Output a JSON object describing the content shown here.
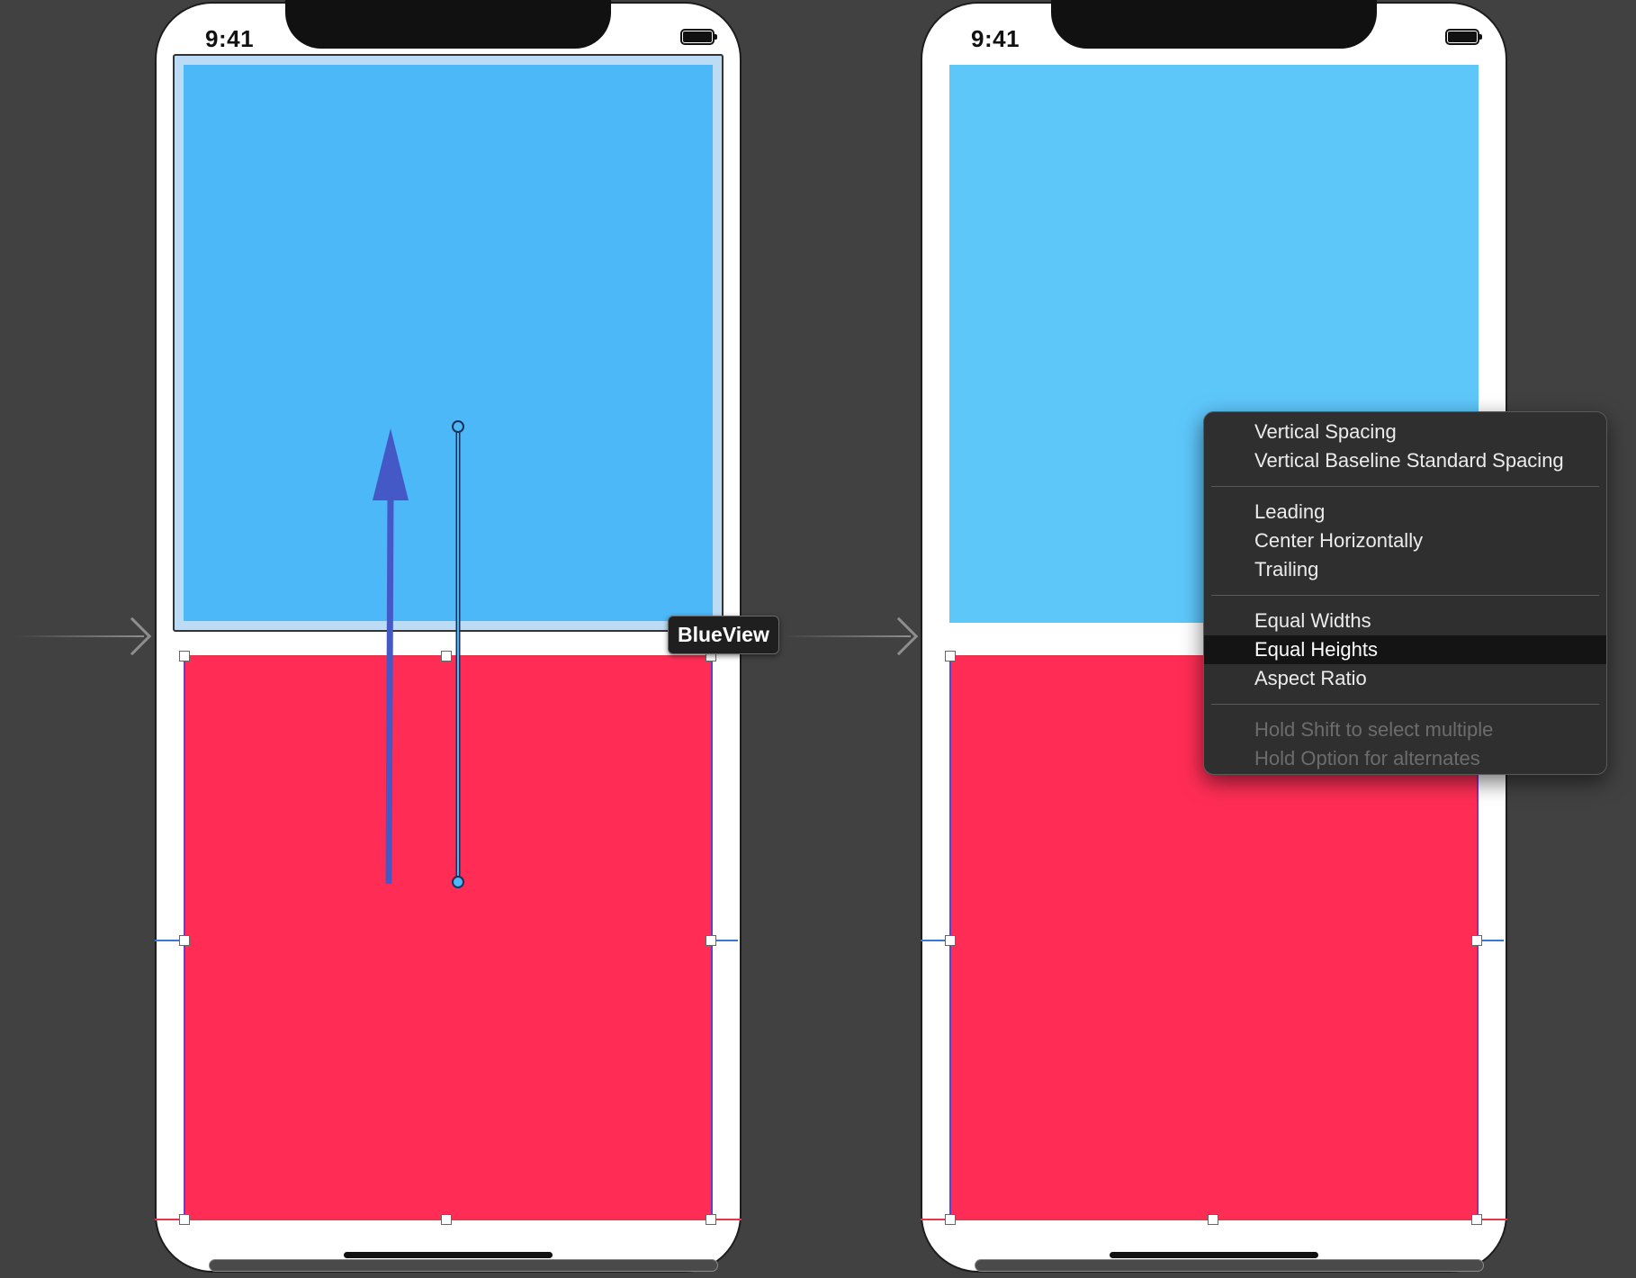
{
  "left_device": {
    "status_time": "9:41",
    "tooltip_label": "BlueView",
    "blue_color": "#4db8f8",
    "red_color": "#ff2d55",
    "drag_arrow_color": "#4559c6"
  },
  "right_device": {
    "status_time": "9:41",
    "blue_color": "#5ec7fa",
    "red_color": "#ff2d55"
  },
  "constraint_menu": {
    "sections": [
      {
        "items": [
          {
            "label": "Vertical Spacing"
          },
          {
            "label": "Vertical Baseline Standard Spacing"
          }
        ]
      },
      {
        "items": [
          {
            "label": "Leading"
          },
          {
            "label": "Center Horizontally"
          },
          {
            "label": "Trailing"
          }
        ]
      },
      {
        "items": [
          {
            "label": "Equal Widths"
          },
          {
            "label": "Equal Heights",
            "highlighted": true
          },
          {
            "label": "Aspect Ratio"
          }
        ]
      },
      {
        "items": [
          {
            "label": "Hold Shift to select multiple",
            "disabled": true
          },
          {
            "label": "Hold Option for alternates",
            "disabled": true
          }
        ]
      }
    ]
  }
}
